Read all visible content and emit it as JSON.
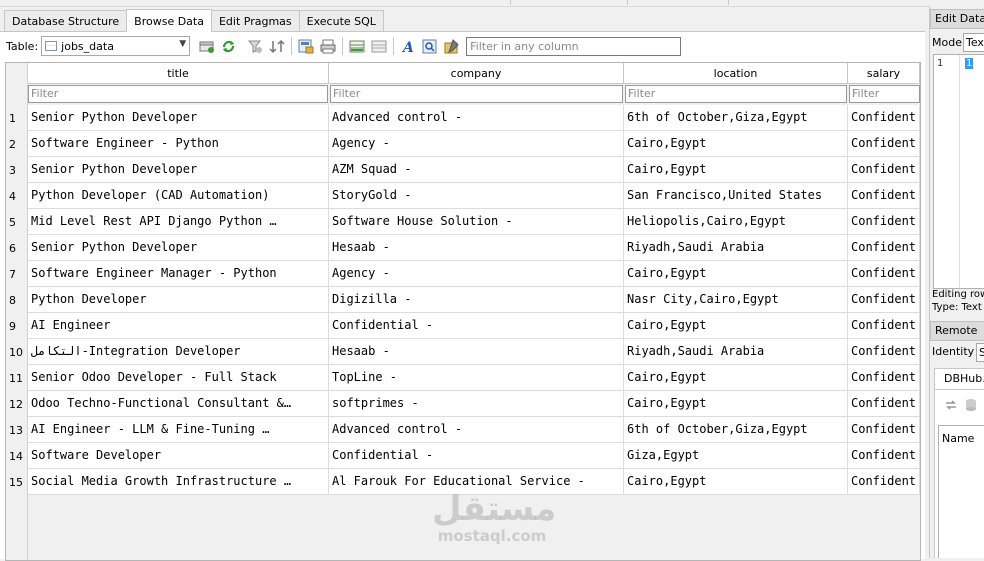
{
  "tabs": [
    {
      "label": "Database Structure",
      "active": false
    },
    {
      "label": "Browse Data",
      "active": true
    },
    {
      "label": "Edit Pragmas",
      "active": false
    },
    {
      "label": "Execute SQL",
      "active": false
    }
  ],
  "toolbar": {
    "table_label": "Table:",
    "table_value": "jobs_data",
    "filter_placeholder": "Filter in any column"
  },
  "grid": {
    "columns": [
      "title",
      "company",
      "location",
      "salary"
    ],
    "filter_placeholder": "Filter",
    "rows": [
      {
        "n": "1",
        "cells": [
          "Senior Python Developer",
          "Advanced control -",
          "6th of October,Giza,Egypt",
          "Confident"
        ]
      },
      {
        "n": "2",
        "cells": [
          "Software Engineer - Python",
          "Agency -",
          "Cairo,Egypt",
          "Confident"
        ]
      },
      {
        "n": "3",
        "cells": [
          "Senior Python Developer",
          "AZM Squad -",
          "Cairo,Egypt",
          "Confident"
        ]
      },
      {
        "n": "4",
        "cells": [
          "Python Developer (CAD Automation)",
          "StoryGold -",
          "San Francisco,United States",
          "Confident"
        ]
      },
      {
        "n": "5",
        "cells": [
          "Mid Level Rest API Django Python …",
          "Software House Solution  -",
          "Heliopolis,Cairo,Egypt",
          "Confident"
        ]
      },
      {
        "n": "6",
        "cells": [
          "Senior Python Developer",
          "Hesaab  -",
          "Riyadh,Saudi Arabia",
          "Confident"
        ]
      },
      {
        "n": "7",
        "cells": [
          "Software Engineer Manager - Python",
          "Agency -",
          "Cairo,Egypt",
          "Confident"
        ]
      },
      {
        "n": "8",
        "cells": [
          "Python Developer",
          "Digizilla -",
          "Nasr City,Cairo,Egypt",
          "Confident"
        ]
      },
      {
        "n": "9",
        "cells": [
          "AI Engineer",
          "Confidential -",
          "Cairo,Egypt",
          "Confident"
        ]
      },
      {
        "n": "10",
        "cells": [
          "التكامل-Integration Developer",
          "Hesaab  -",
          "Riyadh,Saudi Arabia",
          "Confident"
        ]
      },
      {
        "n": "11",
        "cells": [
          "Senior Odoo Developer - Full Stack",
          "TopLine  -",
          "Cairo,Egypt",
          "Confident"
        ]
      },
      {
        "n": "12",
        "cells": [
          "Odoo Techno-Functional Consultant &…",
          "softprimes -",
          "Cairo,Egypt",
          "Confident"
        ]
      },
      {
        "n": "13",
        "cells": [
          "AI Engineer - LLM & Fine-Tuning …",
          "Advanced control -",
          "6th of October,Giza,Egypt",
          "Confident"
        ]
      },
      {
        "n": "14",
        "cells": [
          "Software Developer",
          "Confidential -",
          "Giza,Egypt",
          "Confident"
        ]
      },
      {
        "n": "15",
        "cells": [
          "Social Media Growth Infrastructure …",
          "Al Farouk For Educational Service  -",
          "Cairo,Egypt",
          "Confident"
        ]
      }
    ]
  },
  "edit_panel": {
    "title": "Edit Databa",
    "mode_label": "Mode:",
    "mode_value": "Tex",
    "line_number": "1",
    "cell_value": "1",
    "editing_row": "Editing row",
    "type_label": "Type: Text"
  },
  "remote_panel": {
    "title": "Remote",
    "identity_label": "Identity",
    "identity_value": "S",
    "tab_label": "DBHub.io",
    "name_header": "Name"
  },
  "watermark": {
    "arabic": "مستقل",
    "latin": "mostaql.com"
  }
}
